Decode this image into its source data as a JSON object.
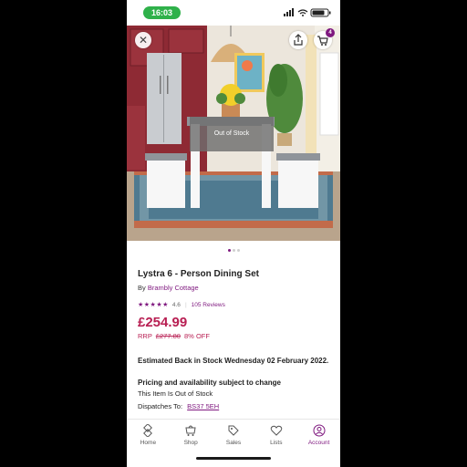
{
  "status_bar": {
    "time": "16:03"
  },
  "hero": {
    "overlay_text": "Out of Stock",
    "cart_count": "4"
  },
  "product": {
    "title": "Lystra 6 - Person Dining Set",
    "brand_prefix": "By",
    "brand": "Brambly Cottage",
    "rating": "4.6",
    "reviews": "105 Reviews",
    "price": "£254.99",
    "rrp_label": "RRP",
    "rrp_price": "£277.80",
    "discount": "8% OFF"
  },
  "availability": {
    "estimated": "Estimated Back in Stock Wednesday 02 February 2022.",
    "pricing_note": "Pricing and availability subject to change",
    "out_of_stock": "This Item Is Out of Stock",
    "dispatch_label": "Dispatches To:",
    "postcode": "BS37 5EH"
  },
  "nav": {
    "items": [
      {
        "label": "Home",
        "icon": "home-icon"
      },
      {
        "label": "Shop",
        "icon": "shop-icon"
      },
      {
        "label": "Sales",
        "icon": "tag-icon"
      },
      {
        "label": "Lists",
        "icon": "heart-icon"
      },
      {
        "label": "Account",
        "icon": "account-icon"
      }
    ]
  },
  "colors": {
    "brand": "#7f187f",
    "price": "#b81e52",
    "time_pill": "#2fb14a"
  }
}
